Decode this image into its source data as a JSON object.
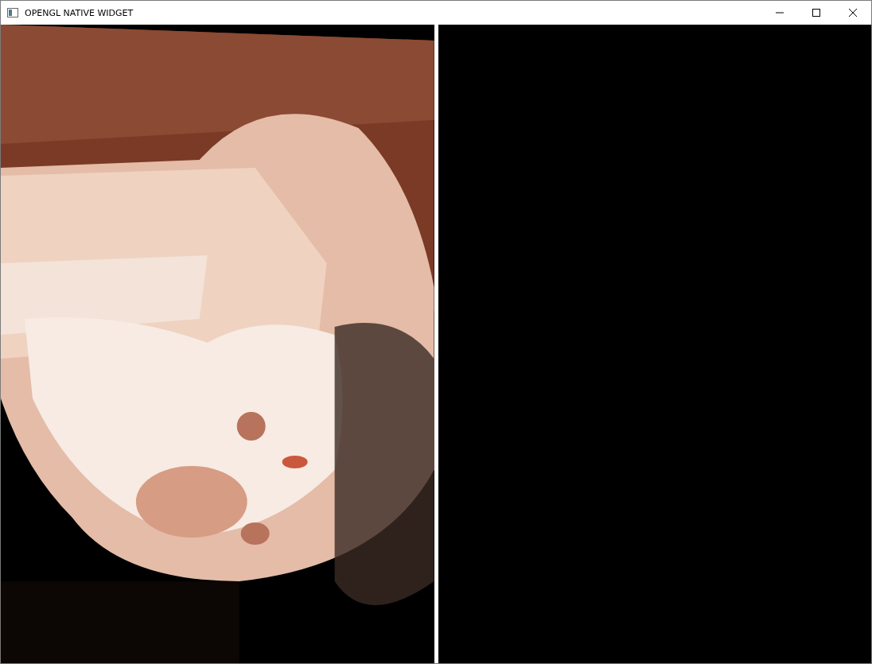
{
  "window": {
    "title": "OPENGL NATIVE WIDGET"
  },
  "views": [
    {
      "kind": "picture"
    },
    {
      "kind": "empty"
    }
  ]
}
